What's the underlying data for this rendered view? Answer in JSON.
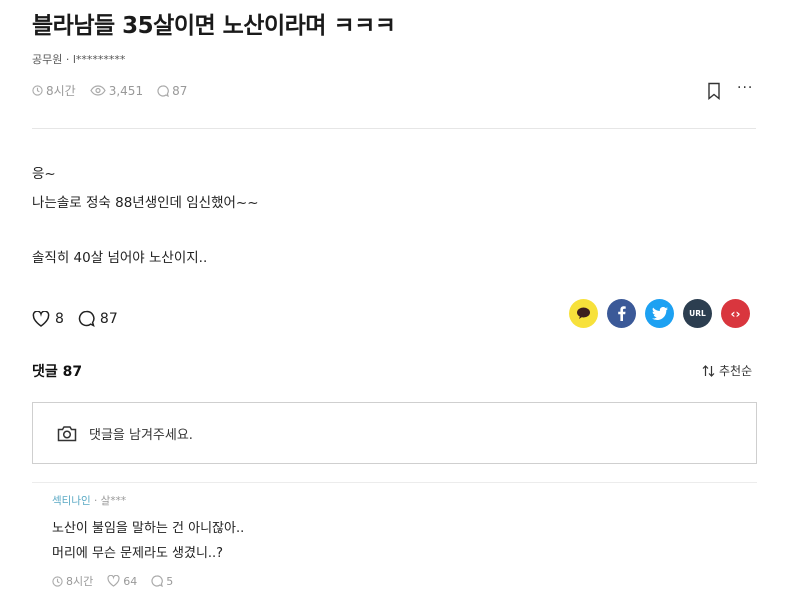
{
  "post": {
    "title": "블라남들 35살이면 노산이라며 ㅋㅋㅋ",
    "author": "공무원 · l*********",
    "time": "8시간",
    "views": "3,451",
    "comments": "87",
    "body": [
      "응~",
      "나는솔로 정숙 88년생인데 임신했어~~",
      "솔직히 40살 넘어야 노산이지.."
    ],
    "likes": "8",
    "comment_count": "87",
    "more_label": "···"
  },
  "share": {
    "kakao_color": "#f7e13b",
    "facebook_color": "#3b5998",
    "twitter_color": "#1da1f2",
    "url_color": "#2c3e50",
    "embed_color": "#d9363e",
    "url_label": "URL",
    "embed_label": "‹›"
  },
  "comments_section": {
    "header": "댓글 87",
    "sort_label": "추천순",
    "input_placeholder": "댓글을 남겨주세요."
  },
  "comment": {
    "nickname": "섹티나인",
    "handle": "· 살***",
    "lines": [
      "노산이 불임을 말하는 건 아니잖아..",
      "머리에 무슨 문제라도 생겼니..?"
    ],
    "time": "8시간",
    "likes": "64",
    "replies": "5"
  }
}
